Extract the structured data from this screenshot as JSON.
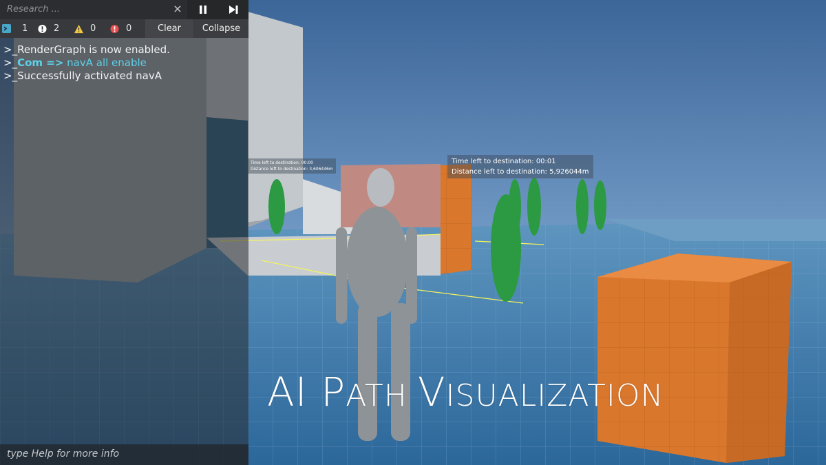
{
  "console": {
    "search_placeholder": "Research ...",
    "clear_search_glyph": "×",
    "pause_icon": "pause-icon",
    "step_icon": "step-forward-icon",
    "stats": [
      {
        "icon": "terminal-icon",
        "count": "1",
        "color": "#49a7c9"
      },
      {
        "icon": "info-icon",
        "count": "2",
        "color": "#ffffff"
      },
      {
        "icon": "warning-icon",
        "count": "0",
        "color": "#f3c843"
      },
      {
        "icon": "error-icon",
        "count": "0",
        "color": "#e94f4f"
      }
    ],
    "clear_label": "Clear",
    "collapse_label": "Collapse",
    "log": {
      "line1": ">_RenderGraph is now enabled.",
      "line2_prefix": ">_",
      "line2_cmd": "Com =>",
      "line2_rest": " navA all enable",
      "line3": ">_Successfully activated navA"
    },
    "hint": "type Help for more info"
  },
  "overlay_title": {
    "part1": "AI ",
    "p_big": "P",
    "p_small": "ATH ",
    "v_big": "V",
    "v_small": "ISUALIZATION"
  },
  "world_labels": {
    "main_time": "Time left to destination: 00:01",
    "main_distance": "Distance left to destination: 5,926044m",
    "left_time": "Time left to destination: 00:00",
    "left_distance": "Distance left to destination: 3,606446m"
  },
  "colors": {
    "sky_top": "#3f6a9c",
    "sky_bottom": "#8fb6d6",
    "floor": "#2f6ea0",
    "orange": "#d9772d",
    "wall": "#9ea3a8",
    "agent_green": "#2c9a43"
  }
}
